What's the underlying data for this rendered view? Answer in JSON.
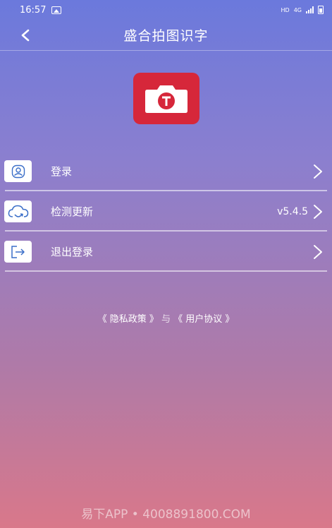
{
  "status_bar": {
    "time": "16:57",
    "hd": "HD",
    "network": "4G"
  },
  "header": {
    "title": "盛合拍图识字"
  },
  "menu": {
    "items": [
      {
        "label": "登录",
        "value": ""
      },
      {
        "label": "检测更新",
        "value": "v5.4.5"
      },
      {
        "label": "退出登录",
        "value": ""
      }
    ]
  },
  "policy": {
    "privacy": "《 隐私政策 》",
    "and": "与",
    "agreement": "《 用户协议 》"
  },
  "watermark": "易下APP • 4008891800.COM"
}
